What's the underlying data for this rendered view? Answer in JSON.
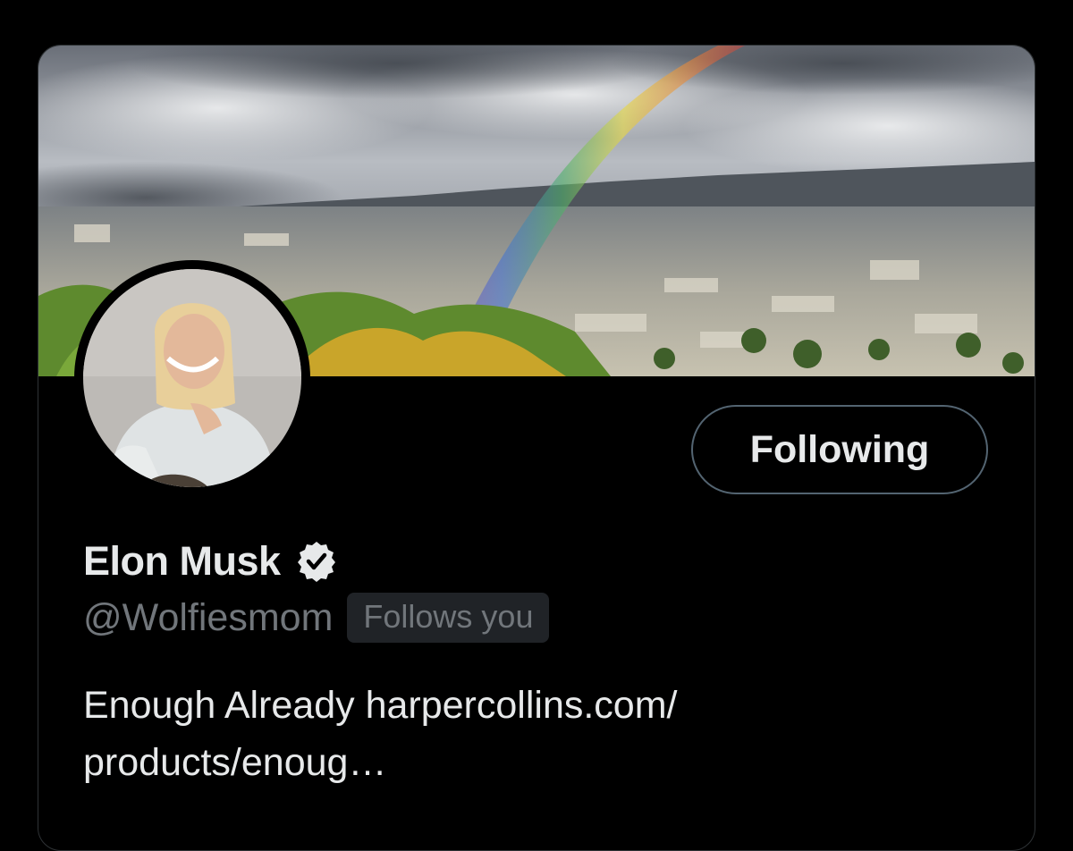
{
  "profile": {
    "display_name": "Elon Musk",
    "handle": "@Wolfiesmom",
    "follows_you_label": "Follows you",
    "verified": true,
    "bio_prefix": "Enough Already ",
    "bio_link_line1": "harpercollins.com/",
    "bio_link_line2": "products/enoug…"
  },
  "actions": {
    "following_label": "Following"
  },
  "icons": {
    "verified": "verified-badge-icon"
  },
  "colors": {
    "background": "#000000",
    "primary_text": "#e7e9ea",
    "secondary_text": "#71767b",
    "button_border": "#536471",
    "badge_bg": "#202327"
  }
}
